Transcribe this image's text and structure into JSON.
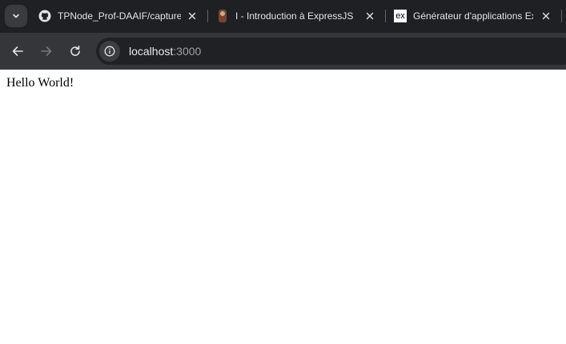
{
  "tabs": [
    {
      "title": "TPNode_Prof-DAAIF/capture",
      "favicon": "github-icon",
      "active": false
    },
    {
      "title": "I - Introduction à ExpressJS",
      "favicon": "person-avatar-icon",
      "active": false
    },
    {
      "title": "Générateur d'applications Ex",
      "favicon": "express-icon",
      "favicon_text": "ex",
      "active": false
    }
  ],
  "address_bar": {
    "host": "localhost",
    "port": ":3000"
  },
  "page": {
    "text": "Hello World!"
  },
  "colors": {
    "tabstrip": "#1f2023",
    "toolbar": "#35363a",
    "omnibox": "#202124",
    "page_bg": "#ffffff"
  }
}
